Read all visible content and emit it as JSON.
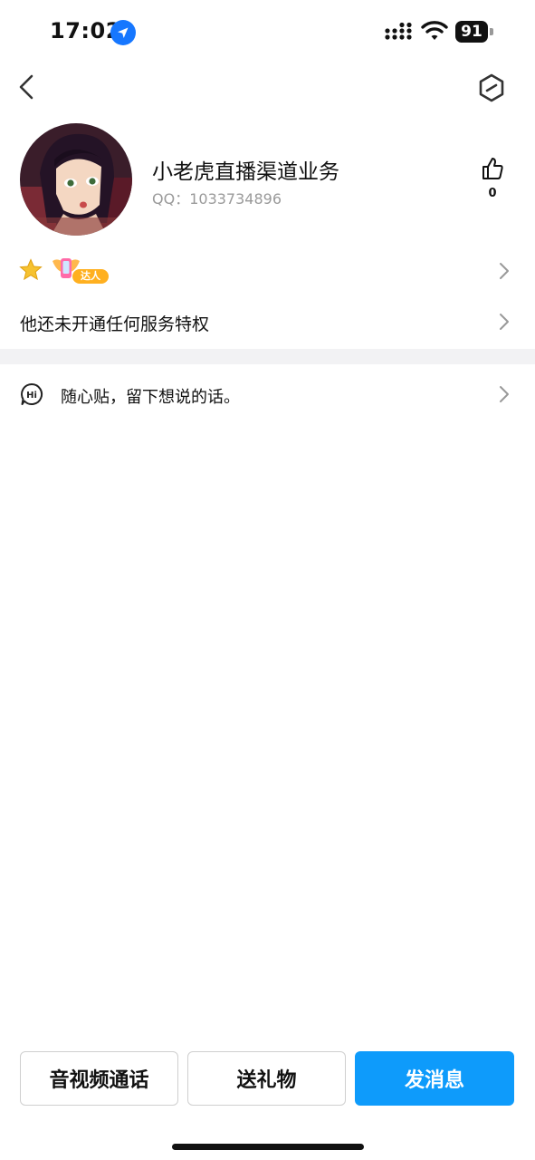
{
  "status_bar": {
    "time": "17:02",
    "battery": "91"
  },
  "profile": {
    "nickname": "小老虎直播渠道业务",
    "qq_label": "QQ：",
    "qq_number": "1033734896",
    "like_count": "0"
  },
  "badges": {
    "daren_label": "达人"
  },
  "privilege": {
    "text": "他还未开通任何服务特权"
  },
  "note": {
    "text": "随心贴，留下想说的话。"
  },
  "actions": {
    "call_label": "音视频通话",
    "gift_label": "送礼物",
    "message_label": "发消息"
  },
  "colors": {
    "accent": "#0e9bfb",
    "location_icon": "#1677ff",
    "secondary_text": "#9a9a9a",
    "divider": "#f2f2f4"
  },
  "icons": [
    "location-arrow-icon",
    "signal-icon",
    "wifi-icon",
    "battery-icon",
    "back-chevron-icon",
    "settings-hexagon-icon",
    "thumbs-up-icon",
    "star-icon",
    "daren-badge-icon",
    "chevron-right-icon",
    "hi-chat-icon"
  ]
}
